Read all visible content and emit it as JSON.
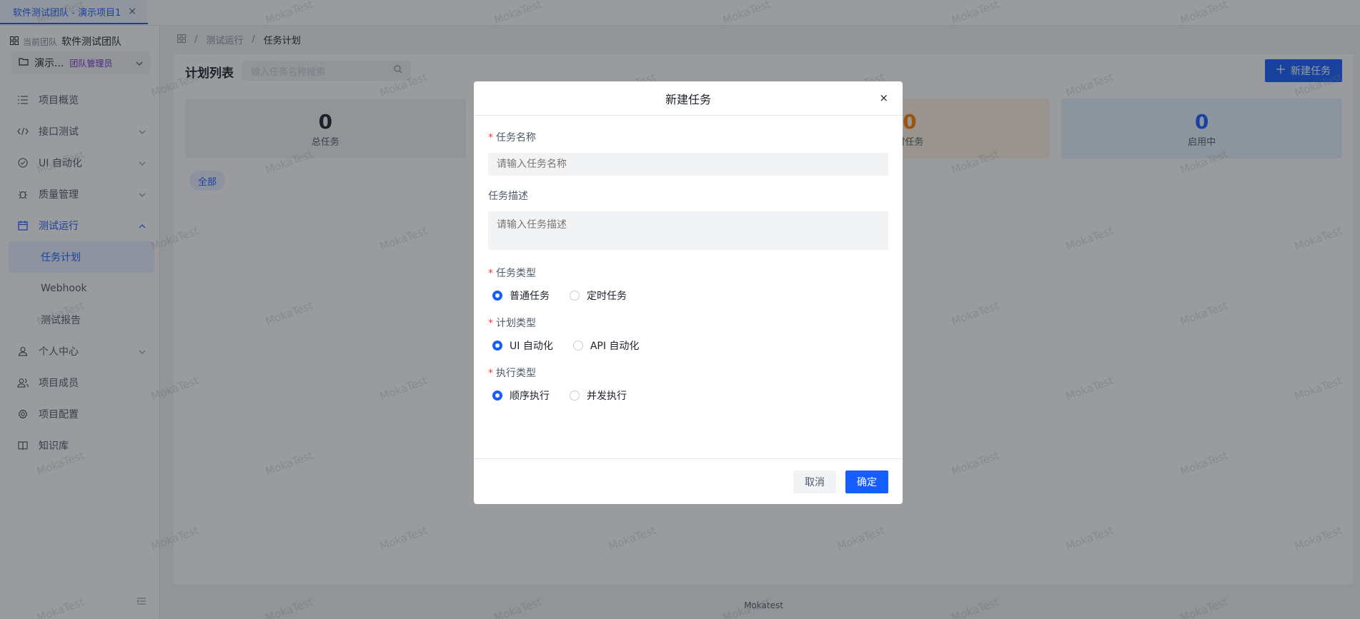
{
  "tab": {
    "label": "软件测试团队 - 演示项目1",
    "close": "×"
  },
  "sidebar": {
    "team_prefix": "当前团队",
    "team_name": "软件测试团队",
    "project_name": "演示...",
    "project_tag": "团队管理员",
    "items": [
      {
        "label": "项目概览"
      },
      {
        "label": "接口测试"
      },
      {
        "label": "UI 自动化"
      },
      {
        "label": "质量管理"
      },
      {
        "label": "测试运行"
      },
      {
        "label": "任务计划"
      },
      {
        "label": "Webhook"
      },
      {
        "label": "测试报告"
      },
      {
        "label": "个人中心"
      },
      {
        "label": "项目成员"
      },
      {
        "label": "项目配置"
      },
      {
        "label": "知识库"
      }
    ]
  },
  "breadcrumb": {
    "level1": "测试运行",
    "sep": "/",
    "current": "任务计划"
  },
  "main": {
    "title": "计划列表",
    "search_placeholder": "输入任务名称搜索",
    "new_button": "新建任务",
    "stats": [
      {
        "value": "0",
        "label": "总任务"
      },
      {
        "value": "",
        "label": ""
      },
      {
        "value": "0",
        "label": "时任务"
      },
      {
        "value": "0",
        "label": "启用中"
      }
    ],
    "filter_all": "全部"
  },
  "footer": {
    "text": "Mokatest"
  },
  "watermark": "MokaTest",
  "modal": {
    "title": "新建任务",
    "close": "×",
    "fields": {
      "name_label": "任务名称",
      "name_placeholder": "请输入任务名称",
      "desc_label": "任务描述",
      "desc_placeholder": "请输入任务描述",
      "task_type_label": "任务类型",
      "task_type_options": [
        "普通任务",
        "定时任务"
      ],
      "task_type_selected": "普通任务",
      "plan_type_label": "计划类型",
      "plan_type_options": [
        "UI 自动化",
        "API 自动化"
      ],
      "plan_type_selected": "UI 自动化",
      "exec_type_label": "执行类型",
      "exec_type_options": [
        "顺序执行",
        "并发执行"
      ],
      "exec_type_selected": "顺序执行"
    },
    "cancel": "取消",
    "confirm": "确定"
  },
  "colors": {
    "primary": "#165dff",
    "danger": "#f53f3f",
    "warning": "#ff7d00"
  }
}
